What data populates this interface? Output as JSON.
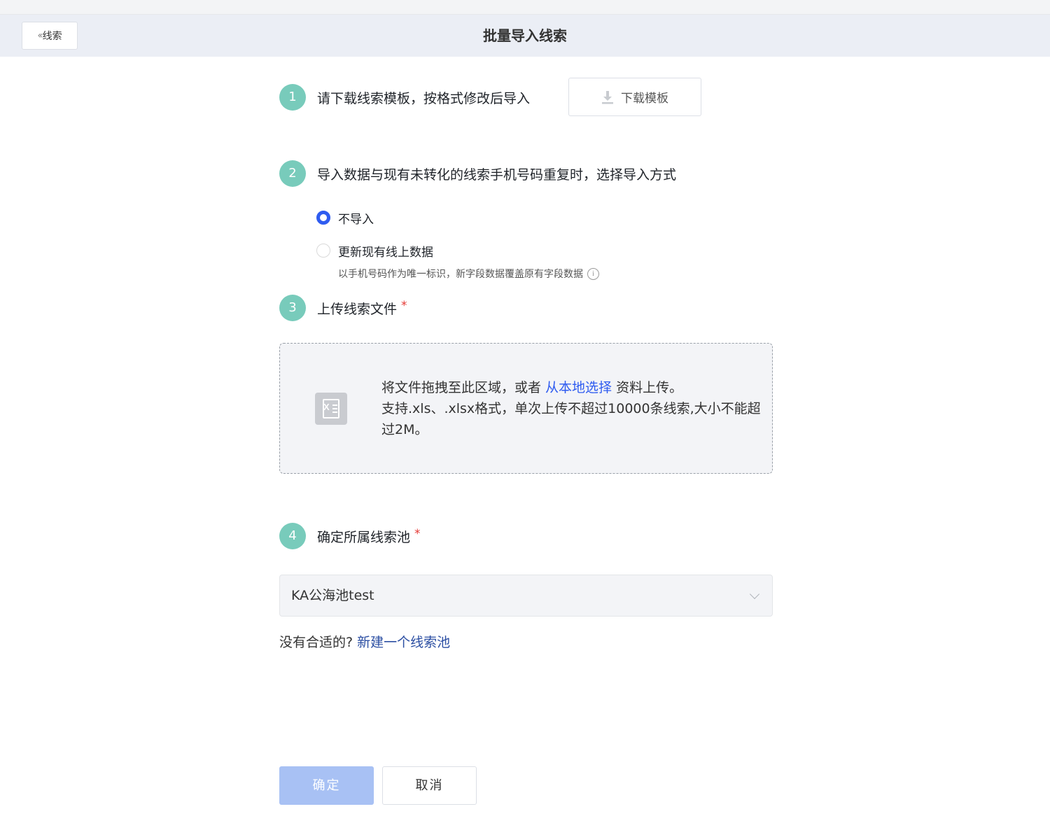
{
  "header": {
    "back_label": "线索",
    "title": "批量导入线索"
  },
  "steps": [
    {
      "num": "1",
      "text": "请下载线索模板，按格式修改后导入"
    },
    {
      "num": "2",
      "text": "导入数据与现有未转化的线索手机号码重复时，选择导入方式"
    },
    {
      "num": "3",
      "text": "上传线索文件"
    },
    {
      "num": "4",
      "text": "确定所属线索池"
    }
  ],
  "required_mark": "*",
  "download": {
    "label": "下载模板"
  },
  "import_mode": {
    "options": [
      {
        "label": "不导入",
        "checked": true
      },
      {
        "label": "更新现有线上数据",
        "checked": false
      }
    ],
    "hint": "以手机号码作为唯一标识，新字段数据覆盖原有字段数据",
    "info_icon": "i"
  },
  "upload": {
    "text_before": "将文件拖拽至此区域，或者 ",
    "link": "从本地选择",
    "text_after": " 资料上传。",
    "formats": "支持.xls、.xlsx格式，单次上传不超过10000条线索,大小不能超过2M。",
    "file_icon_letter": "X"
  },
  "pool": {
    "selected": "KA公海池test",
    "no_match_text": "没有合适的?",
    "create_link": "新建一个线索池"
  },
  "buttons": {
    "ok": "确定",
    "cancel": "取消"
  },
  "colors": {
    "step_badge": "#78cbbb",
    "link": "#2f5cf0",
    "primary_disabled": "#a8c1f4",
    "required": "#e53935"
  }
}
